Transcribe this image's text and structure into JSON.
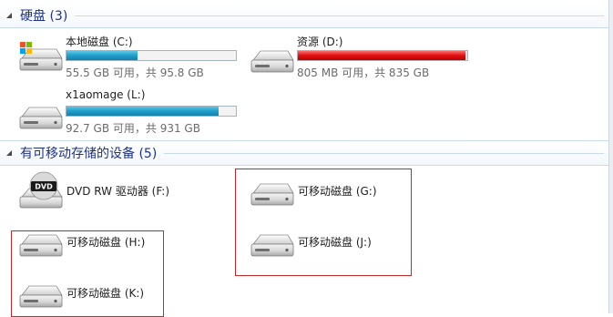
{
  "groups": {
    "hard_disks": {
      "title": "硬盘 (3)"
    },
    "removable": {
      "title": "有可移动存储的设备 (5)"
    }
  },
  "drives": {
    "c": {
      "name": "本地磁盘 (C:)",
      "size_text": "55.5 GB 可用，共 95.8 GB",
      "used_fraction": 0.42,
      "bar_color": "#1f9ec9"
    },
    "d": {
      "name": "资源 (D:)",
      "size_text": "805 MB 可用，共 835 GB",
      "used_fraction": 0.99,
      "bar_color": "#e01010"
    },
    "l": {
      "name": "x1aomage (L:)",
      "size_text": "92.7 GB 可用，共 931 GB",
      "used_fraction": 0.9,
      "bar_color": "#1f9ec9"
    }
  },
  "devices": {
    "dvd": {
      "name": "DVD RW 驱动器 (F:)",
      "icon": "dvd-drive-icon",
      "icon_text": "DVD"
    },
    "g": {
      "name": "可移动磁盘 (G:)",
      "icon": "removable-disk-icon"
    },
    "j": {
      "name": "可移动磁盘 (J:)",
      "icon": "removable-disk-icon"
    },
    "h": {
      "name": "可移动磁盘 (H:)",
      "icon": "removable-disk-icon"
    },
    "k": {
      "name": "可移动磁盘 (K:)",
      "icon": "removable-disk-icon"
    }
  },
  "highlight_color": "#c62828"
}
